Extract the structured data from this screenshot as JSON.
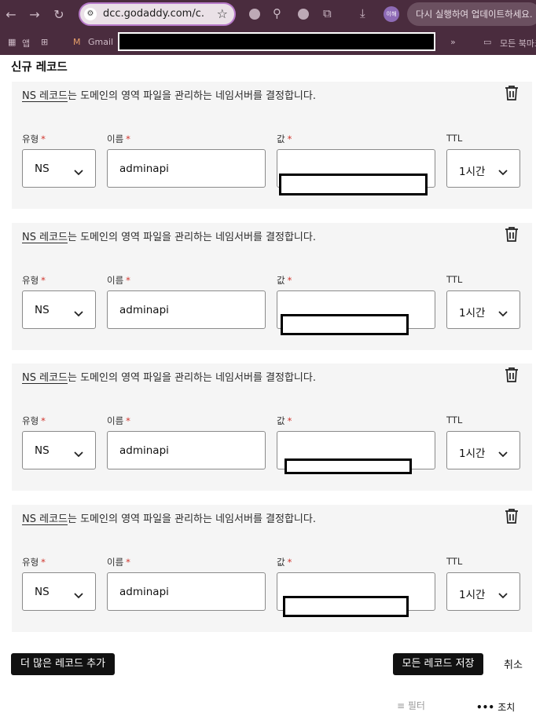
{
  "browser": {
    "url": "dcc.godaddy.com/c...",
    "profile_label": "이해",
    "update_label": "다시 실행하여 업데이트하세요.",
    "bookmarks": {
      "apps": "앱",
      "gmail": "Gmail",
      "more": "»",
      "all_bookmarks": "모든 북마크"
    }
  },
  "page": {
    "title": "신규 레코드"
  },
  "labels": {
    "desc_link": "NS 레코드",
    "desc_rest": "는 도메인의 영역 파일을 관리하는 네임서버를 결정합니다.",
    "type": "유형",
    "name": "이름",
    "value": "값",
    "ttl": "TTL",
    "required": "*"
  },
  "records": [
    {
      "type": "NS",
      "name": "adminapi",
      "value": "",
      "ttl": "1시간"
    },
    {
      "type": "NS",
      "name": "adminapi",
      "value": "",
      "ttl": "1시간"
    },
    {
      "type": "NS",
      "name": "adminapi",
      "value": "",
      "ttl": "1시간"
    },
    {
      "type": "NS",
      "name": "adminapi",
      "value": "",
      "ttl": "1시간"
    }
  ],
  "actions": {
    "add_more": "더 많은 레코드 추가",
    "save_all": "모든 레코드 저장",
    "cancel": "취소",
    "filter": "필터",
    "action": "조치"
  },
  "colors": {
    "chrome_bg": "#4a2c3e",
    "card_bg": "#f5f5f5",
    "button_dark": "#111111",
    "required_star": "#d0342c"
  }
}
